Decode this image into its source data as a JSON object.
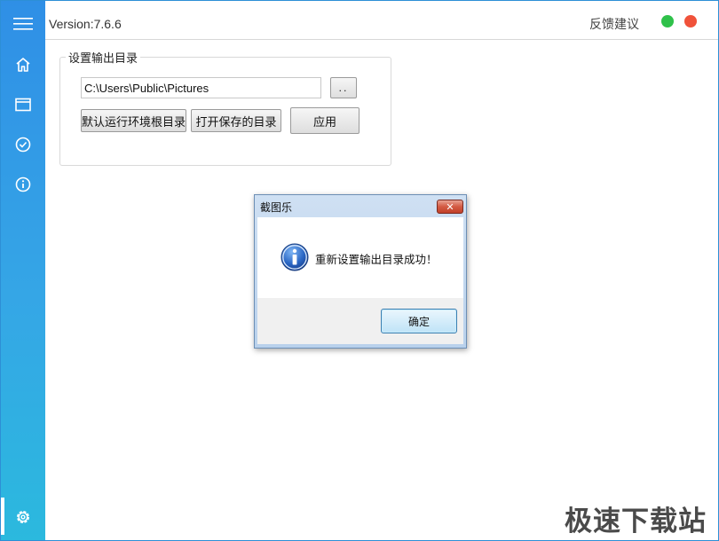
{
  "app": {
    "version": "Version:7.6.6",
    "feedback": "反馈建议"
  },
  "colors": {
    "sidebar_top": "#2f8fe6",
    "sidebar_bottom": "#2bb9de",
    "minimize_dot": "#2fc14a",
    "close_dot": "#f0523a"
  },
  "sidebar": {
    "icons": [
      "menu-icon",
      "home-icon",
      "window-icon",
      "check-circle-icon",
      "info-circle-icon",
      "gear-icon"
    ]
  },
  "output_dir": {
    "legend": "设置输出目录",
    "path_value": "C:\\Users\\Public\\Pictures",
    "browse_label": "..",
    "default_dir_button": "默认运行环境根目录",
    "open_dir_button": "打开保存的目录",
    "apply_button": "应用"
  },
  "dialog": {
    "title": "截图乐",
    "close": "✕",
    "message": "重新设置输出目录成功！",
    "ok_button": "确定",
    "icon": "info-icon"
  },
  "watermark": "极速下载站"
}
